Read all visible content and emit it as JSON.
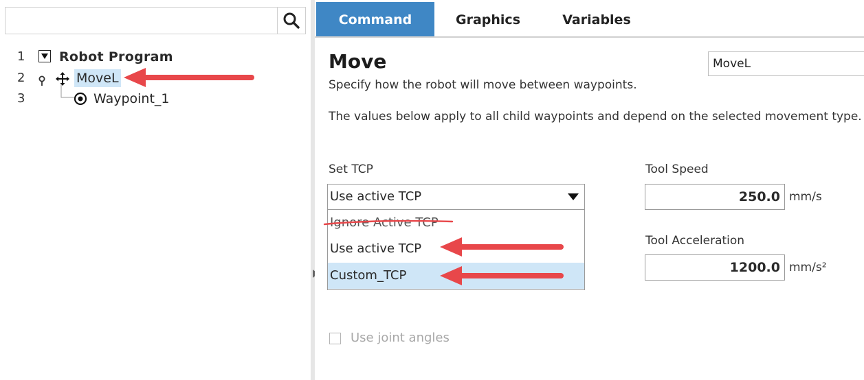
{
  "search": {
    "value": "",
    "icon": "search-icon"
  },
  "tree": {
    "rows": [
      {
        "number": "1",
        "label": "Robot Program",
        "icon": "expand-triangle-icon"
      },
      {
        "number": "2",
        "label": "MoveL",
        "icon": "move-cross-icon",
        "marker": "breakpoint-pin-icon"
      },
      {
        "number": "3",
        "label": "Waypoint_1",
        "icon": "waypoint-target-icon"
      }
    ]
  },
  "tabs": [
    {
      "label": "Command",
      "active": true
    },
    {
      "label": "Graphics",
      "active": false
    },
    {
      "label": "Variables",
      "active": false
    }
  ],
  "move": {
    "title": "Move",
    "name_value": "MoveL",
    "subtitle": "Specify how the robot will move between waypoints.",
    "note": "The values below apply to all child waypoints and depend on the selected movement type.",
    "set_tcp": {
      "label": "Set TCP",
      "selected": "Use active TCP",
      "options": [
        "Ignore Active TCP",
        "Use active TCP",
        "Custom_TCP"
      ]
    },
    "tool_speed": {
      "label": "Tool Speed",
      "value": "250.0",
      "unit": "mm/s"
    },
    "tool_acceleration": {
      "label": "Tool Acceleration",
      "value": "1200.0",
      "unit": "mm/s²"
    },
    "joint_angles": {
      "label": "Use joint angles",
      "checked": false
    }
  },
  "colors": {
    "tab_active": "#3f87c5",
    "selection": "#cfe6f7",
    "annotation_arrow": "#e8474a"
  }
}
